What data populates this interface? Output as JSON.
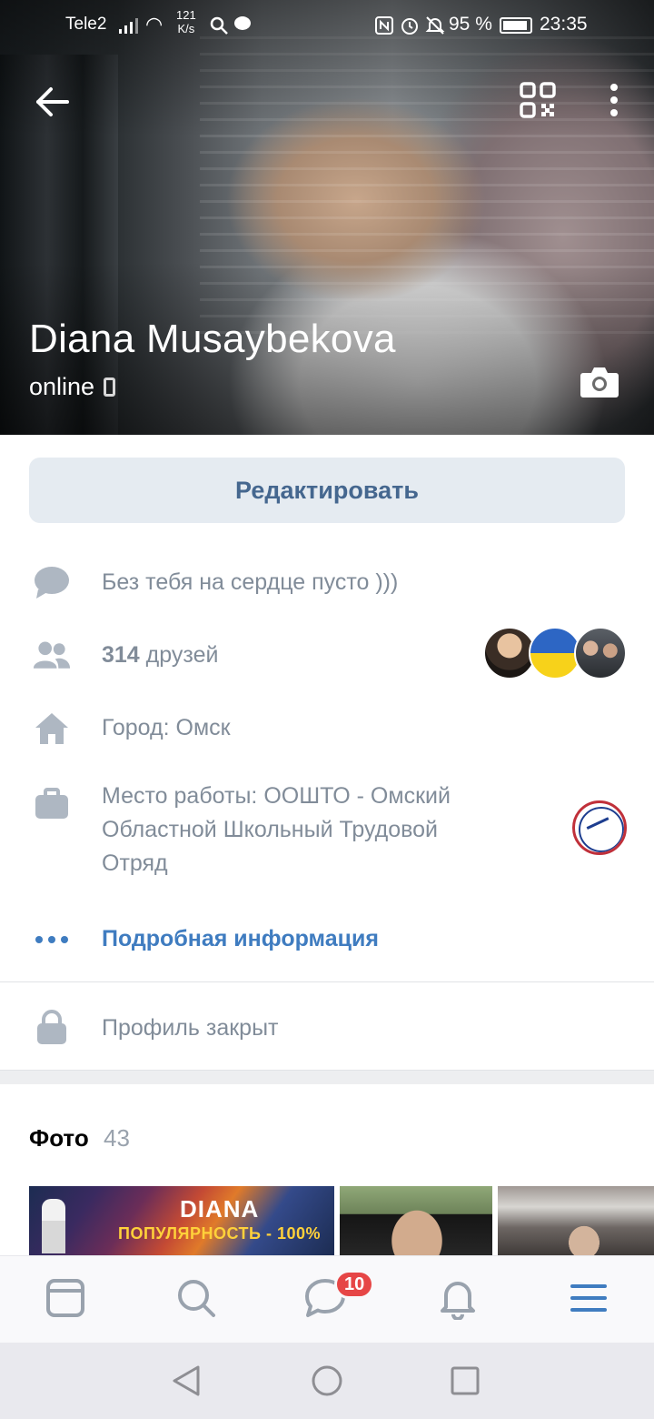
{
  "status_bar": {
    "carrier": "Tele2",
    "net_speed_value": "121",
    "net_speed_unit": "K/s",
    "battery_percent": "95 %",
    "time": "23:35"
  },
  "profile": {
    "name": "Diana Musaybekova",
    "online_status": "online",
    "edit_label": "Редактировать"
  },
  "info": {
    "status_text": "Без тебя на сердце пусто )))",
    "friends_count": "314",
    "friends_label": "друзей",
    "city": "Город: Омск",
    "work_lines": [
      "Место работы: ООШТО - Омский",
      "Областной Школьный Трудовой",
      "Отряд"
    ],
    "more_info": "Подробная информация",
    "closed": "Профиль закрыт"
  },
  "photos": {
    "title": "Фото",
    "count": "43",
    "first_photo_title": "DIANA",
    "first_photo_subtitle": "ПОПУЛЯРНОСТЬ - 100%"
  },
  "tabbar": {
    "messages_badge": "10"
  },
  "colors": {
    "accent": "#3f7cc0",
    "edit_button_bg": "#e5ebf1",
    "edit_button_text": "#45678f",
    "secondary_text": "#818c99",
    "icon_gray": "#aeb7c2",
    "badge": "#e64646"
  },
  "icons": {
    "back": "arrow-left-icon",
    "qr": "qr-code-icon",
    "more": "more-vertical-icon",
    "camera": "camera-icon",
    "status": "speech-bubble-icon",
    "friends": "users-icon",
    "city": "home-icon",
    "work": "briefcase-icon",
    "more_info": "dots-horizontal-icon",
    "closed": "lock-icon",
    "tab_feed": "feed-icon",
    "tab_search": "search-icon",
    "tab_messages": "messages-icon",
    "tab_notifications": "bell-icon",
    "tab_menu": "menu-icon"
  }
}
